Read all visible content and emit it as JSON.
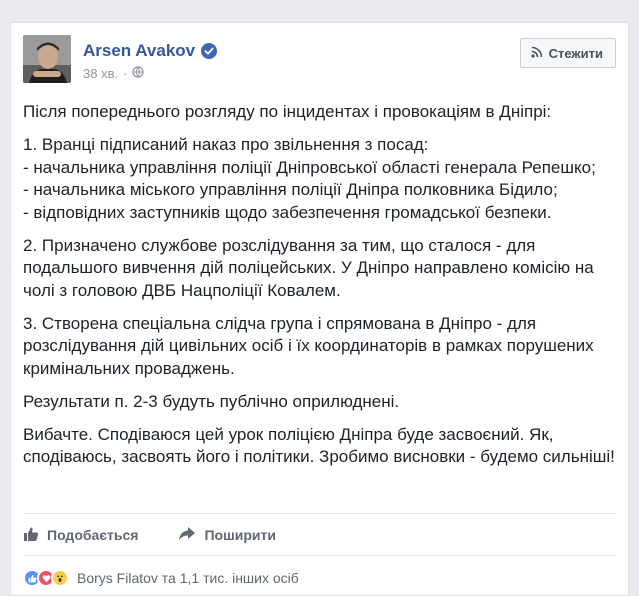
{
  "post": {
    "author": "Arsen Avakov",
    "time": "38 хв.",
    "follow_label": "Стежити",
    "paragraphs": [
      "Після попереднього розгляду по інцидентах і провокаціям в Дніпрі:",
      "1. Вранці підписаний наказ про звільнення з посад:\n- начальника управління поліції Дніпровської області генерала Репешко;\n- начальника міського управління поліції Дніпра полковника Бідило;\n- відповідних заступників щодо забезпечення громадської безпеки.",
      "2. Призначено службове розслідування за тим, що сталося - для подальшого вивчення дій поліцейських. У Дніпро направлено комісію на чолі з головою ДВБ Нацполіції Ковалем.",
      "3. Створена спеціальна слідча група і спрямована в Дніпро - для розслідування дій цивільних осіб і їх координаторів в рамках порушених кримінальних проваджень.",
      "Результати п. 2-3 будуть публічно оприлюднені.",
      "Вибачте. Сподіваюся цей урок поліцією Дніпра буде засвоєний. Як, сподіваюсь, засвоять його і політики. Зробимо висновки - будемо сильнішi!"
    ]
  },
  "actions": {
    "like_label": "Подобається",
    "share_label": "Поширити"
  },
  "reactions": {
    "summary": "Borys Filatov та 1,1 тис. інших осіб"
  },
  "colors": {
    "link_blue": "#365899",
    "brand_blue": "#4267b2",
    "like_blue": "#5890ff",
    "love_red": "#f25268",
    "wow_yellow": "#fbcd44"
  }
}
